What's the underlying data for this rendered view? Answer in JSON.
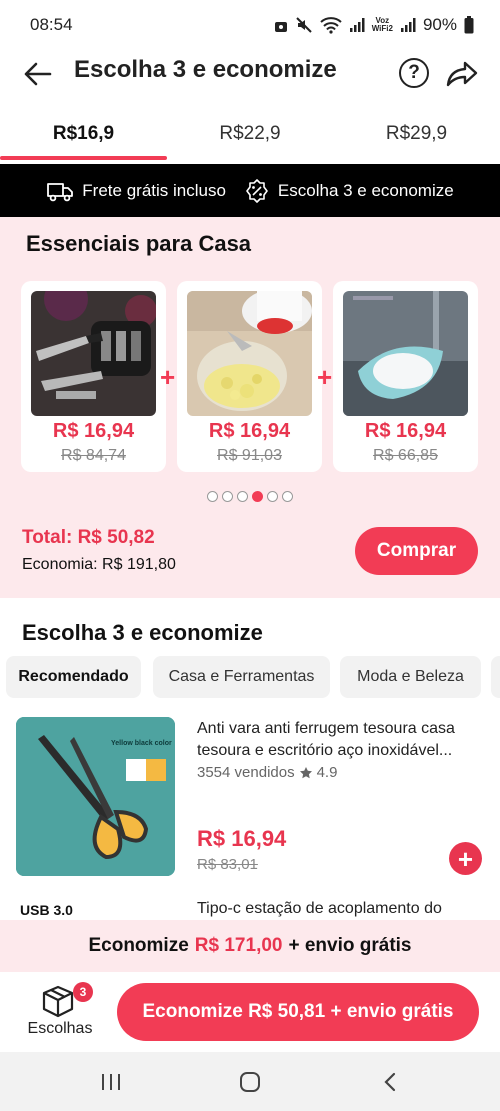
{
  "status": {
    "time": "08:54",
    "battery": "90%",
    "network_label": "Voz\nWiFi2"
  },
  "header": {
    "title": "Escolha 3 e economize"
  },
  "tabs": [
    {
      "label": "R$16,9",
      "active": true
    },
    {
      "label": "R$22,9",
      "active": false
    },
    {
      "label": "R$29,9",
      "active": false
    }
  ],
  "banner": {
    "shipping": "Frete grátis incluso",
    "choose": "Escolha 3 e economize"
  },
  "bundle": {
    "title": "Essenciais para Casa",
    "products": [
      {
        "name": "knife-sharpener",
        "price": "R$ 16,94",
        "old_price": "R$ 84,74"
      },
      {
        "name": "food-chopper",
        "price": "R$ 16,94",
        "old_price": "R$ 91,03"
      },
      {
        "name": "soap-dish",
        "price": "R$ 16,94",
        "old_price": "R$ 66,85"
      }
    ],
    "pages": 6,
    "active_page": 4,
    "total": "Total: R$ 50,82",
    "economy": "Economia: R$ 191,80",
    "buy_label": "Comprar"
  },
  "list": {
    "title": "Escolha 3 e economize",
    "chips": [
      {
        "label": "Recomendado",
        "active": true
      },
      {
        "label": "Casa e Ferramentas",
        "active": false
      },
      {
        "label": "Moda e Beleza",
        "active": false
      }
    ],
    "items": [
      {
        "title": "Anti vara anti ferrugem tesoura casa tesoura e escritório aço inoxidável...",
        "sold": "3554 vendidos",
        "rating": "4.9",
        "price": "R$ 16,94",
        "old_price": "R$ 83,01",
        "img_label": "Yellow black color"
      },
      {
        "title": "Tipo-c estação de acoplamento do",
        "img_label": "USB 3.0"
      }
    ]
  },
  "savings": {
    "prefix": "Economize",
    "amount": "R$ 171,00",
    "suffix": "+ envio grátis"
  },
  "bottom": {
    "choices_label": "Escolhas",
    "choices_count": "3",
    "cta_label": "Economize R$ 50,81 + envio grátis"
  },
  "colors": {
    "accent": "#f23c55",
    "price": "#e8354f",
    "pink_bg": "#fde9ec"
  }
}
